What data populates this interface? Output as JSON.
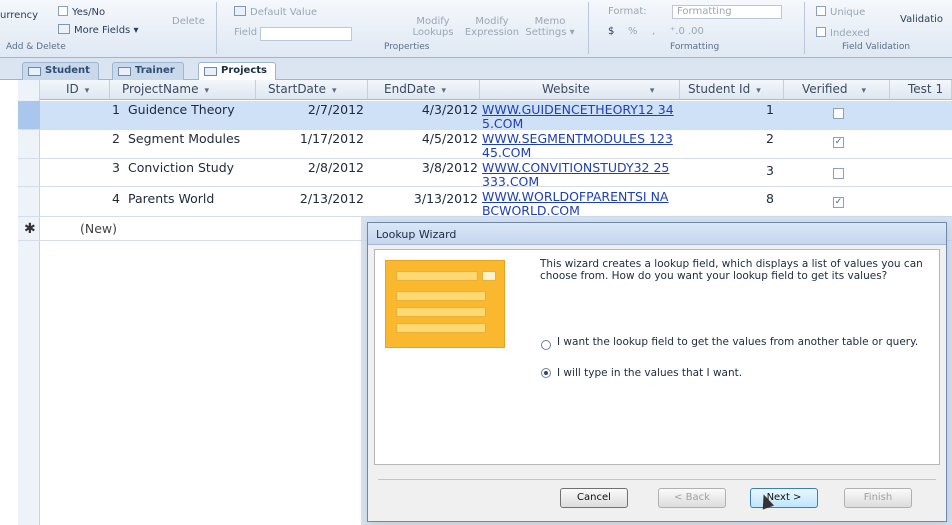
{
  "ribbon": {
    "currency": "urrency",
    "yesno": "Yes/No",
    "more_fields": "More Fields ▾",
    "delete": "Delete",
    "add_delete_group": "Add & Delete",
    "default_value": "Default Value",
    "field_size": "Field Size",
    "modify_lookups": "Modify Lookups",
    "modify_expression": "Modify Expression",
    "memo_settings": "Memo Settings ▾",
    "properties_group": "Properties",
    "format_label": "Format:",
    "format_value": "Formatting",
    "dollar": "$",
    "percent": "%",
    "comma": ",",
    "decimals": "⁺.0  .00",
    "formatting_group": "Formatting",
    "unique": "Unique",
    "indexed": "Indexed",
    "validation": "Validatio",
    "field_validation_group": "Field Validation"
  },
  "tabs": [
    {
      "label": "Student"
    },
    {
      "label": "Trainer"
    },
    {
      "label": "Projects"
    }
  ],
  "columns": [
    {
      "label": "ID"
    },
    {
      "label": "ProjectName"
    },
    {
      "label": "StartDate"
    },
    {
      "label": "EndDate"
    },
    {
      "label": "Website"
    },
    {
      "label": "Student Id"
    },
    {
      "label": "Verified"
    },
    {
      "label": "Test 1"
    }
  ],
  "rows": [
    {
      "id": "1",
      "name": "Guidence Theory",
      "start": "2/7/2012",
      "end": "4/3/2012",
      "web": "WWW.GUIDENCETHEORY12 345.COM",
      "student": "1",
      "verified": false
    },
    {
      "id": "2",
      "name": "Segment Modules",
      "start": "1/17/2012",
      "end": "4/5/2012",
      "web": "WWW.SEGMENTMODULES 12345.COM",
      "student": "2",
      "verified": true
    },
    {
      "id": "3",
      "name": "Conviction Study",
      "start": "2/8/2012",
      "end": "3/8/2012",
      "web": "WWW.CONVITIONSTUDY32 25333.COM",
      "student": "3",
      "verified": false
    },
    {
      "id": "4",
      "name": "Parents World",
      "start": "2/13/2012",
      "end": "3/13/2012",
      "web": "WWW.WORLDOFPARENTSI NABCWORLD.COM",
      "student": "8",
      "verified": true
    }
  ],
  "new_row": "(New)",
  "new_marker": "✱",
  "dialog": {
    "title": "Lookup Wizard",
    "description": "This wizard creates a lookup field, which displays a list of values you can choose from.  How do you want your lookup field to get its values?",
    "option1": "I want the lookup field to get the values from another table or query.",
    "option2": "I will type in the values that I want.",
    "selected_option": 2,
    "buttons": {
      "cancel": "Cancel",
      "back": "< Back",
      "next": "Next >",
      "finish": "Finish"
    }
  }
}
